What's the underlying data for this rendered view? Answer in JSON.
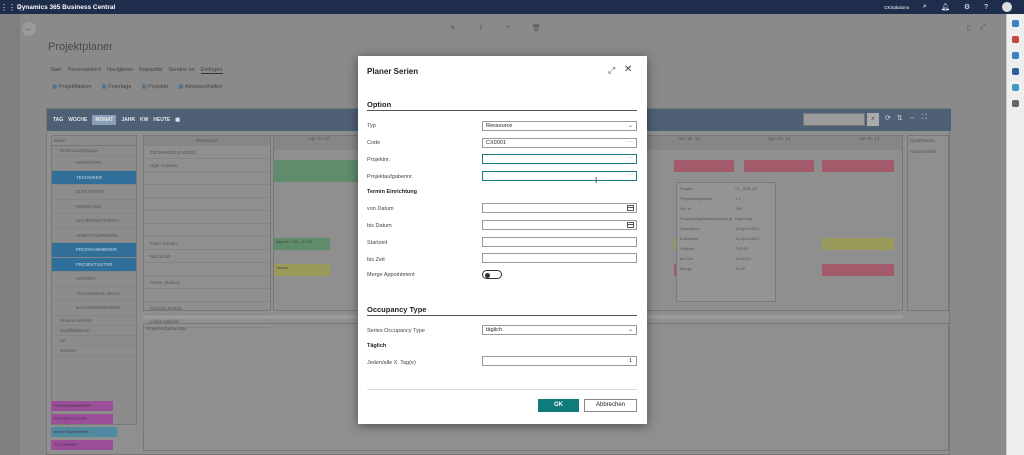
{
  "app": {
    "title": "Dynamics 365 Business Central",
    "company": "CKSolutions"
  },
  "page": {
    "title": "Projektplaner",
    "menu": [
      "Start",
      "Personalisiert",
      "Navigieren",
      "Kapazität",
      "Senden an",
      "Einfügen"
    ],
    "actions": [
      "Projektfarben",
      "Feiertage",
      "Projekte",
      "Abwesenheiten"
    ]
  },
  "planner": {
    "views": [
      "TAG",
      "WOCHE",
      "MONAT",
      "JAHR",
      "KW",
      "HEUTE"
    ],
    "selected_view": "MONAT",
    "tree_header": "Baum",
    "tree_items": [
      {
        "label": "Ressourcengruppe",
        "type": "group"
      },
      {
        "label": "MONTEURE",
        "type": "plain"
      },
      {
        "label": "TECHNIKER",
        "type": "blue"
      },
      {
        "label": "ELEKTRIKER",
        "type": "plain"
      },
      {
        "label": "REINIGUNG",
        "type": "plain"
      },
      {
        "label": "SICHERHEITSTECH...",
        "type": "plain"
      },
      {
        "label": "ARBEITSVORBERE...",
        "type": "plain"
      },
      {
        "label": "PROGRAMMIERER",
        "type": "blue"
      },
      {
        "label": "PROJEKTLEITER",
        "type": "blue"
      },
      {
        "label": "MAURER",
        "type": "plain"
      },
      {
        "label": "TECHNISCHE ZEICH...",
        "type": "plain"
      },
      {
        "label": "BAUUNTERNEHMER",
        "type": "plain"
      },
      {
        "label": "Ressourcenliste",
        "type": "group"
      },
      {
        "label": "Qualifikationen",
        "type": "group"
      },
      {
        "label": "Art",
        "type": "group"
      },
      {
        "label": "Gesamt",
        "type": "group"
      }
    ],
    "resource_header": "Ressource",
    "resource_group": "TECHNIKER (CX0002)",
    "resources": [
      "Ugur Ozkeser",
      "",
      "",
      "",
      "",
      "",
      "Franz Amann",
      "Neil Smith",
      "",
      "Carter Jackson",
      "",
      "Dominik Möhrle",
      "Lukas Haberle"
    ],
    "days": [
      "Apr. Fr. 07",
      "Apr. Mi. 12",
      "Apr. Do. 13",
      "Apr. Fr. 14"
    ],
    "bars": [
      {
        "text": "Tag frei 7:30 – 13:30",
        "color": "green"
      },
      {
        "text": "Termin",
        "color": "olive"
      }
    ],
    "popup_rows": [
      [
        "Projekt",
        "CI-_JOB_01"
      ],
      [
        "Projektaufgabennr.",
        "1.4"
      ],
      [
        "Lfd. nr.",
        "336"
      ],
      [
        "Projektaufgabenbezeichnung",
        "Reporting..."
      ],
      [
        "Startdatum",
        "13.April 2023"
      ],
      [
        "Enddatum",
        "13.April 2023"
      ],
      [
        "Startzeit",
        "7:00:00"
      ],
      [
        "bis Zeit",
        "15:00:00"
      ],
      [
        "Menge",
        "16.00"
      ]
    ],
    "qualifications_header": "Qualifikation",
    "qualifications_item": "Abwesenheit",
    "lower_header": "Projektaufgabenliste",
    "tags": [
      {
        "label": "PROGRAMMIERER",
        "color": "m"
      },
      {
        "label": "PROJEKTLEITER",
        "color": "m"
      },
      {
        "label": "Innere Sicherheiten",
        "color": "t"
      },
      {
        "label": "TECHNIKER",
        "color": "m"
      }
    ]
  },
  "dialog": {
    "title": "Planer Serien",
    "option_section": "Option",
    "typ_label": "Typ",
    "typ_value": "Ressource",
    "code_label": "Code",
    "code_value": "CX0001",
    "projektnr_label": "Projektnr.",
    "projektaufgabennr_label": "Projektaufgabennr.",
    "termin_header": "Termin Einrichtung",
    "von_datum_label": "von Datum",
    "bis_datum_label": "bis Datum",
    "startzeit_label": "Startzeit",
    "bis_zeit_label": "bis Zeit",
    "merge_label": "Merge Appointment",
    "merge_on": false,
    "occupancy_section": "Occupancy Type",
    "series_label": "Series Occupancy Type",
    "series_value": "täglich",
    "daily_header": "Täglich",
    "jeden_label": "Jeden/alle X. Tag(e)",
    "jeden_value": "1",
    "ok_label": "OK",
    "cancel_label": "Abbrechen"
  }
}
